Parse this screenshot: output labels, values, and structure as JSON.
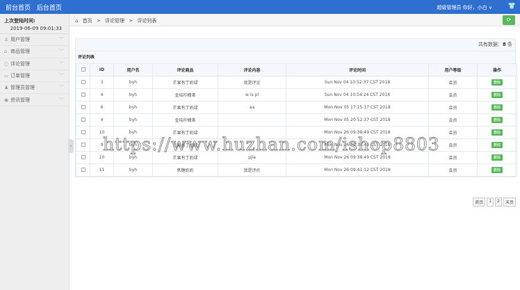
{
  "header": {
    "links": [
      "前台首页",
      "后台首页"
    ],
    "user": "超级管理员 你好，小白 ∨",
    "skin_icon": "shirt-icon"
  },
  "sidebar": {
    "last_login_label": "上次登陆时间:",
    "last_login_time": "2019-06-09 09:01:33",
    "items": [
      {
        "icon": "user-icon",
        "glyph": "♙",
        "label": "用户管理"
      },
      {
        "icon": "bag-icon",
        "glyph": "⌂",
        "label": "商品管理"
      },
      {
        "icon": "comment-icon",
        "glyph": "○",
        "label": "评论管理"
      },
      {
        "icon": "order-icon",
        "glyph": "▭",
        "label": "订单管理"
      },
      {
        "icon": "admin-icon",
        "glyph": "♟",
        "label": "管理员管理"
      },
      {
        "icon": "news-icon",
        "glyph": "◉",
        "label": "资讯管理"
      }
    ]
  },
  "breadcrumb": [
    "首页",
    ">",
    "评论管理",
    ">",
    "评论列表"
  ],
  "total": {
    "label": "共有数据：",
    "count": "8",
    "unit": " 条"
  },
  "panel_title": "评论列表",
  "columns": [
    "ID",
    "用户名",
    "评论商品",
    "评论内容",
    "评论时间",
    "用户等级",
    "操作"
  ],
  "rows": [
    [
      "3",
      "byh",
      "芒果有丁奶绿",
      "我是评论",
      "Sun Nov 04 10:52:37 CST 2018",
      "会员",
      "删除"
    ],
    [
      "4",
      "byh",
      "金桔柠檬茶",
      "w is pl",
      "Sun Nov 04 10:54:24 CST 2018",
      "会员",
      "删除"
    ],
    [
      "6",
      "byh",
      "芒果有丁奶绿",
      "aa",
      "Mon Nov 05 17:15:37 CST 2018",
      "会员",
      "删除"
    ],
    [
      "4",
      "byh",
      "金桔柠檬茶",
      "",
      "Mon Nov 05 20:52:37 CST 2018",
      "会员",
      "删除"
    ],
    [
      "10",
      "byh",
      "芒果有丁奶绿",
      "",
      "Mon Nov 26 09:38:49 CST 2018",
      "会员",
      "删除"
    ],
    [
      "9",
      "byh",
      "芒果有丁奶绿",
      "",
      "Mon Nov 26 09:38:49 CST 2018",
      "会员",
      "删除"
    ],
    [
      "10",
      "byh",
      "芒果有丁奶绿",
      "pjla",
      "Mon Nov 26 09:38:49 CST 2018",
      "会员",
      "删除"
    ],
    [
      "11",
      "byh",
      "焦糖奶奶",
      "我是评价",
      "Mon Nov 26 09:41:12 CST 2018",
      "会员",
      "删除"
    ]
  ],
  "pagination": [
    "首页",
    "1",
    "2",
    "末页"
  ],
  "watermark": "https://www.huzhan.com/ishop8803"
}
